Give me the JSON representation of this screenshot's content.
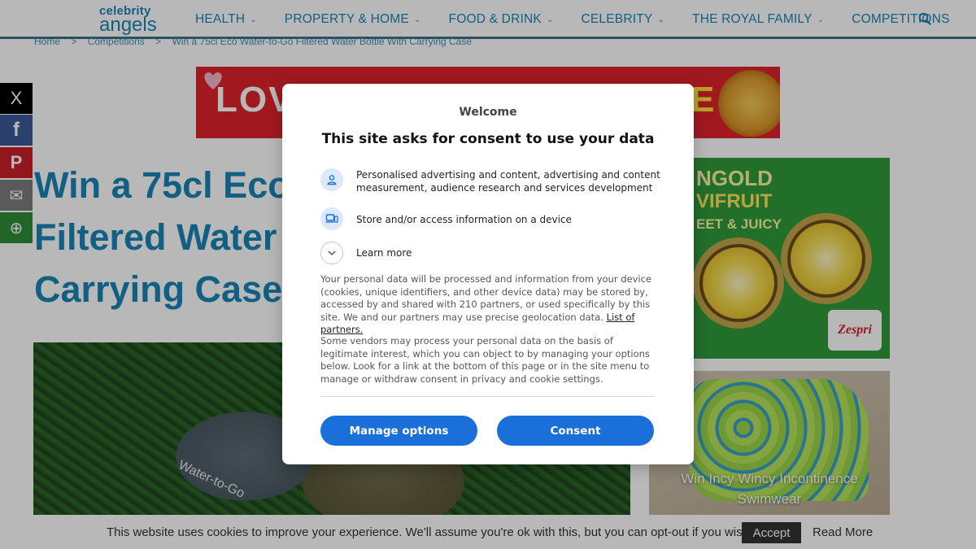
{
  "logo": {
    "line1": "celebrity",
    "line2": "angels"
  },
  "nav": {
    "items": [
      {
        "label": "HEALTH",
        "dropdown": true
      },
      {
        "label": "PROPERTY & HOME",
        "dropdown": true
      },
      {
        "label": "FOOD & DRINK",
        "dropdown": true
      },
      {
        "label": "CELEBRITY",
        "dropdown": true
      },
      {
        "label": "THE ROYAL FAMILY",
        "dropdown": true
      },
      {
        "label": "COMPETITIONS",
        "dropdown": false
      }
    ],
    "chevron": "⌄",
    "search_icon": "search-icon"
  },
  "breadcrumb": {
    "items": [
      "Home",
      ">",
      "Competitions",
      ">",
      "Win a 75cl Eco Water-to-Go Filtered Water Bottle With Carrying Case"
    ]
  },
  "share": [
    {
      "name": "x",
      "glyph": "X",
      "color": "#000000"
    },
    {
      "name": "facebook",
      "glyph": "f",
      "color": "#3b5998"
    },
    {
      "name": "pinterest",
      "glyph": "P",
      "color": "#cb2027"
    },
    {
      "name": "email",
      "glyph": "✉",
      "color": "#7d7d7d"
    },
    {
      "name": "more",
      "glyph": "⊕",
      "color": "#2f8c3a"
    }
  ],
  "banner_ad": {
    "left_text": "LOV",
    "right_text": "E"
  },
  "article": {
    "title_lines": [
      "Win a 75cl Eco",
      "Filtered Water",
      "Carrying Case"
    ]
  },
  "hero": {
    "bottle_text": "Water-to-Go"
  },
  "side_ads": {
    "kiwi": {
      "line1": "NGOLD",
      "line2": "VIFRUIT",
      "line3": "EET & JUICY",
      "brand": "Zespri"
    },
    "swim": {
      "caption": "Win Incy Wincy Incontinence Swimwear"
    }
  },
  "cookie_bar": {
    "message": "This website uses cookies to improve your experience. We'll assume you're ok with this, but you can opt-out if you wish.",
    "accept": "Accept",
    "read_more": "Read More"
  },
  "consent": {
    "welcome": "Welcome",
    "heading": "This site asks for consent to use your data",
    "purposes": [
      {
        "icon": "person-icon",
        "text": "Personalised advertising and content, advertising and content measurement, audience research and services development"
      },
      {
        "icon": "devices-icon",
        "text": "Store and/or access information on a device"
      }
    ],
    "learn_more": "Learn more",
    "para1": "Your personal data will be processed and information from your device (cookies, unique identifiers, and other device data) may be stored by, accessed by and shared with 210 partners, or used specifically by this site. We and our partners may use precise geolocation data.",
    "partners_link": "List of partners.",
    "para2": "Some vendors may process your personal data on the basis of legitimate interest, which you can object to by managing your options below. Look for a link at the bottom of this page or in the site menu to manage or withdraw consent in privacy and cookie settings.",
    "manage_button": "Manage options",
    "consent_button": "Consent"
  },
  "colors": {
    "accent": "#1a84b8",
    "button": "#1a6fd8",
    "nav_border": "#3d6f86"
  }
}
